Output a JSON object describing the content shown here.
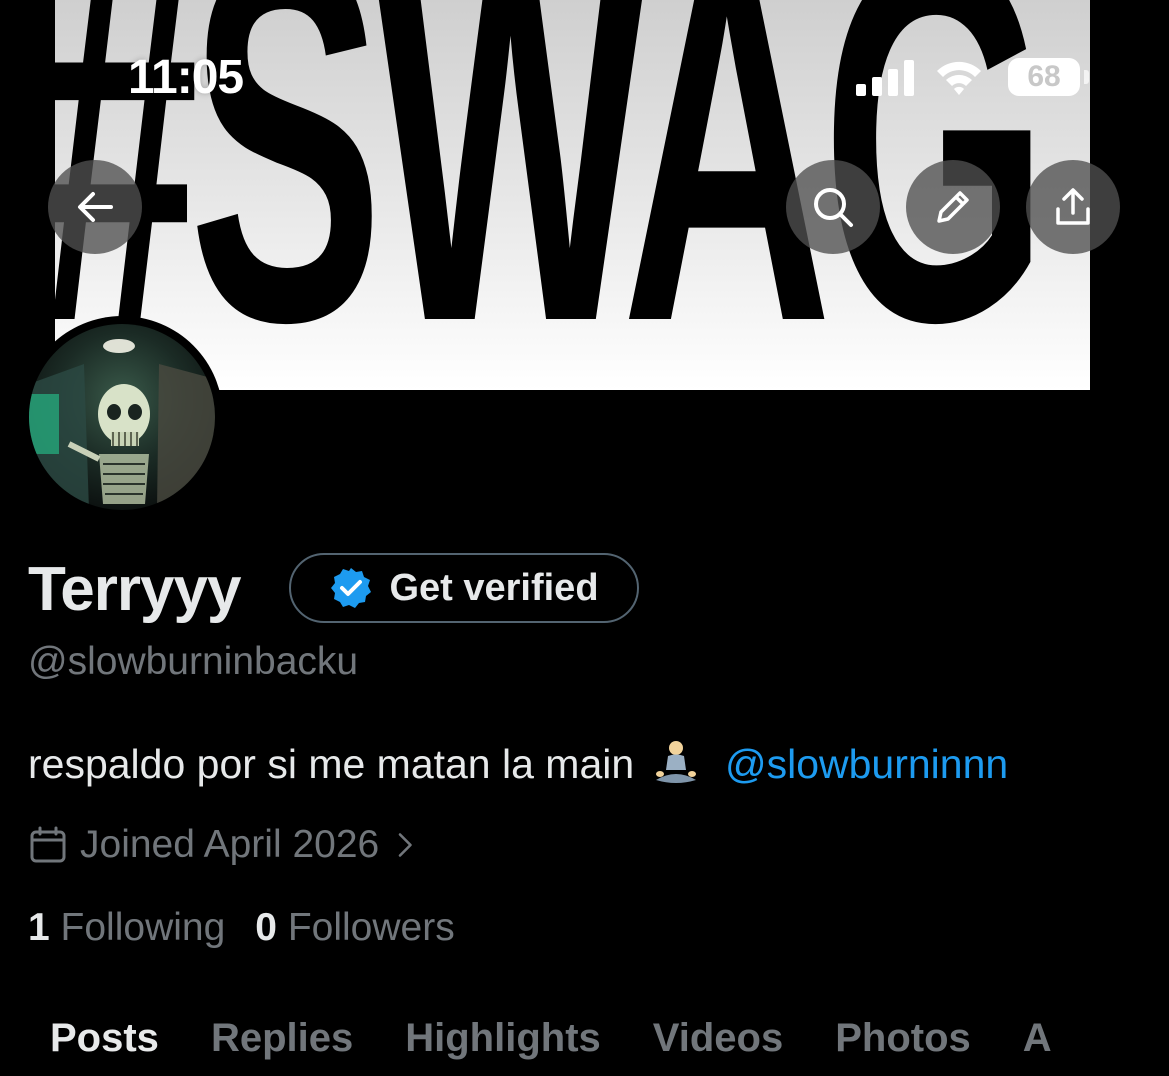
{
  "banner": {
    "text": "#SWAG"
  },
  "status_bar": {
    "time": "11:05",
    "battery": "68"
  },
  "nav": {
    "back_icon": "arrow-left-icon",
    "search_icon": "search-icon",
    "edit_icon": "pencil-icon",
    "share_icon": "share-icon"
  },
  "profile": {
    "display_name": "Terryyy",
    "verify_label": "Get verified",
    "handle": "@slowburninbacku",
    "bio_text": "respaldo por si me matan la main",
    "bio_mention": "@slowburninnn",
    "joined": "Joined April 2026",
    "following_count": "1",
    "following_label": "Following",
    "followers_count": "0",
    "followers_label": "Followers"
  },
  "tabs": [
    "Posts",
    "Replies",
    "Highlights",
    "Videos",
    "Photos",
    "A"
  ],
  "colors": {
    "accent": "#1d9bf0",
    "muted": "#71767b",
    "text": "#e7e9ea",
    "background": "#000000"
  }
}
